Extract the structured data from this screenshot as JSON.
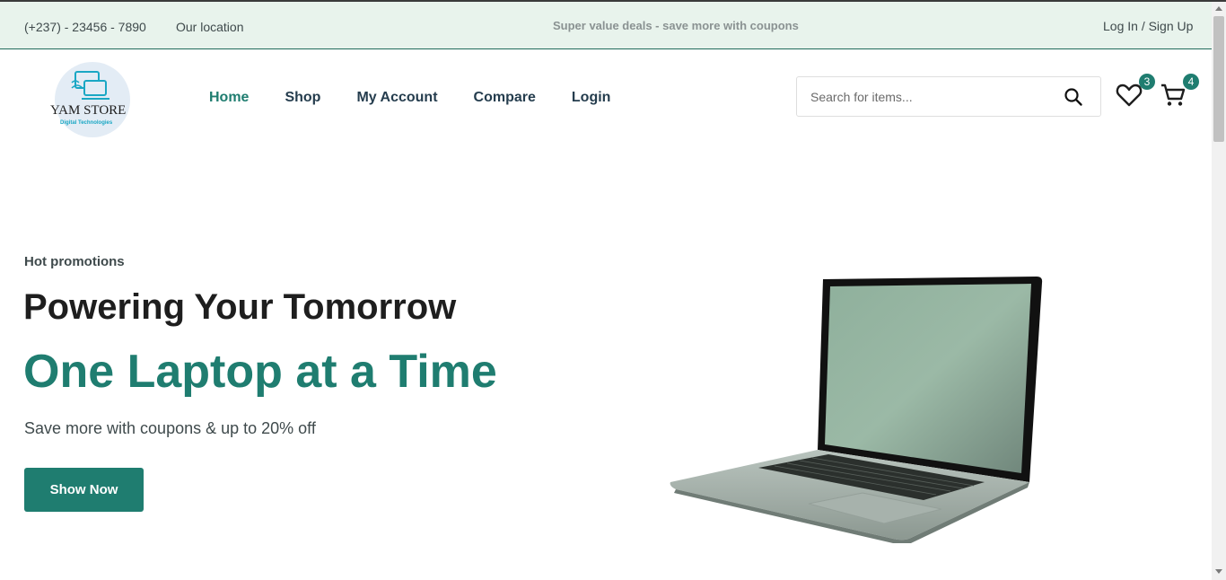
{
  "topbar": {
    "phone": "(+237) - 23456 - 7890",
    "location": "Our location",
    "deals": "Super value deals - save more with coupons",
    "auth": "Log In / Sign Up"
  },
  "logo": {
    "brand": "YAM STORE",
    "tagline": "Digital Technologies"
  },
  "nav": {
    "items": [
      "Home",
      "Shop",
      "My Account",
      "Compare",
      "Login"
    ],
    "active": "Home"
  },
  "search": {
    "placeholder": "Search for items...",
    "icon": "search-icon"
  },
  "wishlist": {
    "icon": "heart-icon",
    "count": "3"
  },
  "cart": {
    "icon": "cart-icon",
    "count": "4"
  },
  "hero": {
    "eyebrow": "Hot promotions",
    "title": "Powering Your Tomorrow",
    "accent": "One Laptop at a Time",
    "subtitle": "Save more with coupons & up to 20% off",
    "button": "Show Now"
  },
  "colors": {
    "accent": "#1f7d70",
    "topbar_bg": "#e8f3ec",
    "text": "#253d4e"
  }
}
